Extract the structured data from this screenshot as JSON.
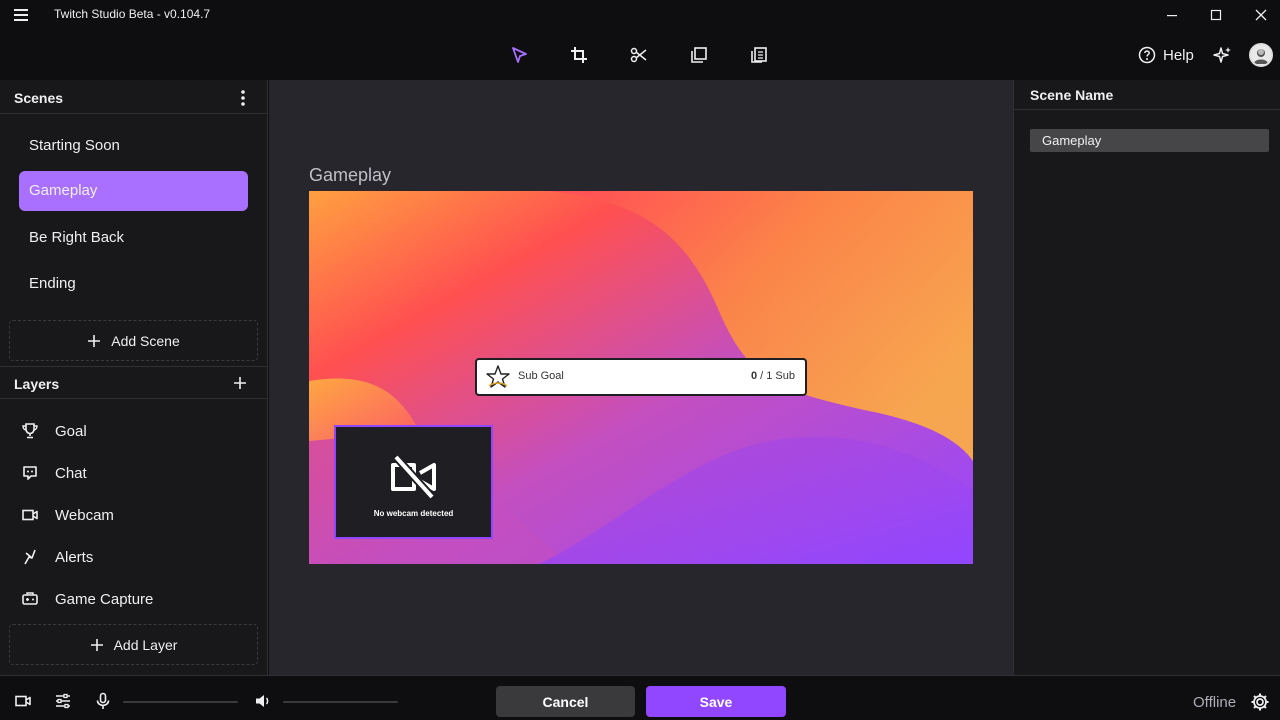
{
  "app": {
    "title": "Twitch Studio Beta - v0.104.7"
  },
  "toolbar": {
    "help_label": "Help"
  },
  "scenes": {
    "title": "Scenes",
    "items": [
      {
        "label": "Starting Soon"
      },
      {
        "label": "Gameplay"
      },
      {
        "label": "Be Right Back"
      },
      {
        "label": "Ending"
      }
    ],
    "add_label": "Add Scene"
  },
  "layers": {
    "title": "Layers",
    "items": [
      {
        "label": "Goal",
        "icon": "trophy-icon"
      },
      {
        "label": "Chat",
        "icon": "chat-icon"
      },
      {
        "label": "Webcam",
        "icon": "camera-icon"
      },
      {
        "label": "Alerts",
        "icon": "alert-icon"
      },
      {
        "label": "Game Capture",
        "icon": "gamepad-icon"
      }
    ],
    "add_label": "Add Layer"
  },
  "preview": {
    "scene_label": "Gameplay",
    "sub_goal": {
      "title": "Sub Goal",
      "current": "0",
      "target": "/ 1 Sub"
    },
    "webcam_message": "No webcam detected"
  },
  "right_panel": {
    "scene_name_label": "Scene Name",
    "scene_name_value": "Gameplay"
  },
  "footer": {
    "cancel_label": "Cancel",
    "save_label": "Save",
    "status": "Offline"
  },
  "colors": {
    "accent": "#9147ff",
    "accent_light": "#a970ff",
    "panel": "#18181b",
    "canvas": "#26262c"
  }
}
